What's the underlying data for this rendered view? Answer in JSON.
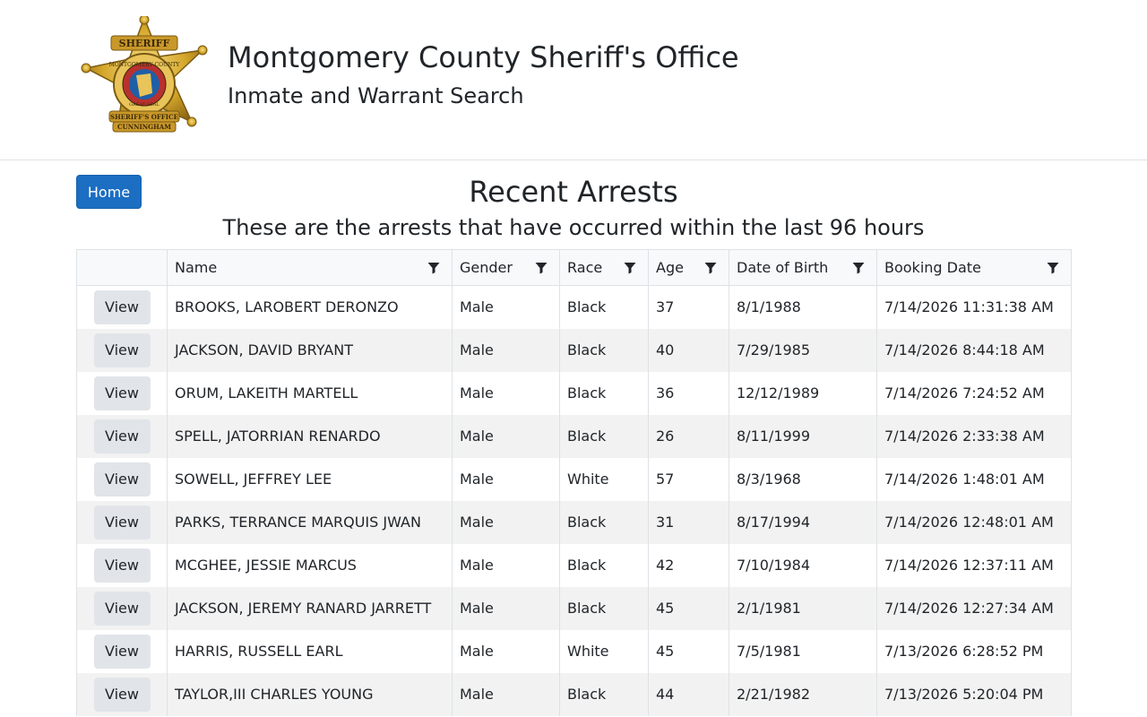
{
  "header": {
    "title": "Montgomery County Sheriff's Office",
    "subtitle": "Inmate and Warrant Search",
    "logo": {
      "top_text": "SHERIFF",
      "ring_text": "MONTGOMERY COUNTY",
      "state_text": "ALABAMA",
      "seal_text": "GREAT SEAL",
      "bottom_text": "SHERIFF'S OFFICE",
      "name_text": "CUNNINGHAM"
    }
  },
  "nav": {
    "home_label": "Home"
  },
  "page": {
    "title": "Recent Arrests",
    "subtitle": "These are the arrests that have occurred within the last 96 hours"
  },
  "table": {
    "columns": [
      "",
      "Name",
      "Gender",
      "Race",
      "Age",
      "Date of Birth",
      "Booking Date"
    ],
    "view_label": "View",
    "rows": [
      {
        "name": "BROOKS, LAROBERT DERONZO",
        "gender": "Male",
        "race": "Black",
        "age": "37",
        "dob": "8/1/1988",
        "booking": "7/14/2026 11:31:38 AM"
      },
      {
        "name": "JACKSON, DAVID BRYANT",
        "gender": "Male",
        "race": "Black",
        "age": "40",
        "dob": "7/29/1985",
        "booking": "7/14/2026 8:44:18 AM"
      },
      {
        "name": "ORUM, LAKEITH MARTELL",
        "gender": "Male",
        "race": "Black",
        "age": "36",
        "dob": "12/12/1989",
        "booking": "7/14/2026 7:24:52 AM"
      },
      {
        "name": "SPELL, JATORRIAN RENARDO",
        "gender": "Male",
        "race": "Black",
        "age": "26",
        "dob": "8/11/1999",
        "booking": "7/14/2026 2:33:38 AM"
      },
      {
        "name": "SOWELL, JEFFREY LEE",
        "gender": "Male",
        "race": "White",
        "age": "57",
        "dob": "8/3/1968",
        "booking": "7/14/2026 1:48:01 AM"
      },
      {
        "name": "PARKS, TERRANCE MARQUIS JWAN",
        "gender": "Male",
        "race": "Black",
        "age": "31",
        "dob": "8/17/1994",
        "booking": "7/14/2026 12:48:01 AM"
      },
      {
        "name": "MCGHEE, JESSIE MARCUS",
        "gender": "Male",
        "race": "Black",
        "age": "42",
        "dob": "7/10/1984",
        "booking": "7/14/2026 12:37:11 AM"
      },
      {
        "name": "JACKSON, JEREMY RANARD JARRETT",
        "gender": "Male",
        "race": "Black",
        "age": "45",
        "dob": "2/1/1981",
        "booking": "7/14/2026 12:27:34 AM"
      },
      {
        "name": "HARRIS, RUSSELL EARL",
        "gender": "Male",
        "race": "White",
        "age": "45",
        "dob": "7/5/1981",
        "booking": "7/13/2026 6:28:52 PM"
      },
      {
        "name": "TAYLOR,III CHARLES YOUNG",
        "gender": "Male",
        "race": "Black",
        "age": "44",
        "dob": "2/21/1982",
        "booking": "7/13/2026 5:20:04 PM"
      }
    ]
  },
  "icons": {
    "column_filter": "filter-icon"
  },
  "colors": {
    "primary_button": "#1b6ec2",
    "view_button": "#e1e5e9",
    "striped_row": "#f2f2f2",
    "header_row": "#f8f9fa",
    "badge_gold": "#d4a62a"
  }
}
